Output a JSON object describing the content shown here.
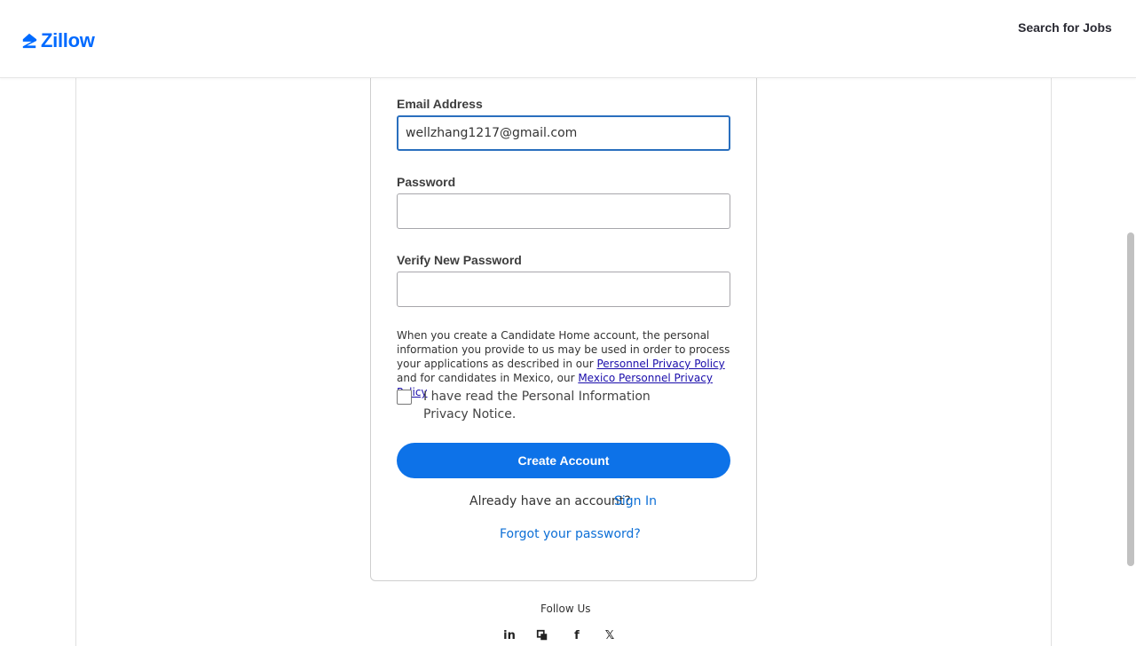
{
  "header": {
    "logo_text": "Zillow",
    "logo_color": "#006aff",
    "search_jobs_label": "Search for Jobs"
  },
  "form": {
    "email": {
      "label": "Email Address",
      "value": "wellzhang1217@gmail.com"
    },
    "password": {
      "label": "Password",
      "value": ""
    },
    "verify_password": {
      "label": "Verify New Password",
      "value": ""
    },
    "notice": {
      "text_before": "When you create a Candidate Home account, the personal information you provide to us may be used in order to process your applications as described in our ",
      "link1": "Personnel Privacy Policy",
      "text_middle": " and for candidates in Mexico, our ",
      "link2": "Mexico Personnel Privacy Policy"
    },
    "privacy_checkbox_label": "I have read the Personal Information Privacy Notice.",
    "create_account_label": "Create Account",
    "already_account_text": "Already have an account?",
    "sign_in_label": "Sign In",
    "forgot_password_label": "Forgot your password?",
    "primary_color": "#0d72e8"
  },
  "footer": {
    "follow_us": "Follow Us",
    "social_icons": [
      "linkedin-icon",
      "glassdoor-icon",
      "facebook-icon",
      "x-icon"
    ]
  }
}
